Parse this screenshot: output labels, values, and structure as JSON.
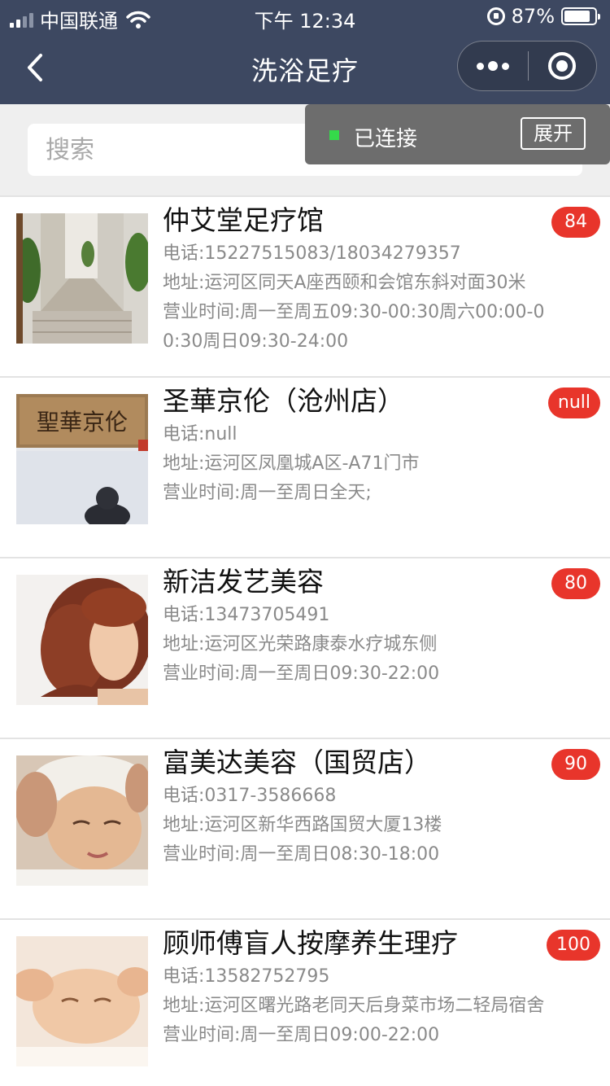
{
  "status_bar": {
    "carrier": "中国联通",
    "time": "下午 12:34",
    "battery": "87%",
    "battery_level": 0.87
  },
  "nav": {
    "title": "洗浴足疗"
  },
  "search": {
    "placeholder": "搜索"
  },
  "toast": {
    "status": "已连接",
    "expand_label": "展开",
    "status_color": "#35d94a"
  },
  "shops": [
    {
      "name": "仲艾堂足疗馆",
      "badge": "84",
      "phone": "电话:15227515083/18034279357",
      "address": "地址:运河区同天A座西颐和会馆东斜对面30米",
      "hours": "营业时间:周一至周五09:30-00:30周六00:00-00:30周日09:30-24:00"
    },
    {
      "name": "圣華京伦（沧州店）",
      "badge": "null",
      "phone": "电话:null",
      "address": "地址:运河区凤凰城A区-A71门市",
      "hours": "营业时间:周一至周日全天;",
      "sign_text": "聖華京伦"
    },
    {
      "name": "新洁发艺美容",
      "badge": "80",
      "phone": "电话:13473705491",
      "address": "地址:运河区光荣路康泰水疗城东侧",
      "hours": "营业时间:周一至周日09:30-22:00"
    },
    {
      "name": "富美达美容（国贸店）",
      "badge": "90",
      "phone": "电话:0317-3586668",
      "address": "地址:运河区新华西路国贸大厦13楼",
      "hours": "营业时间:周一至周日08:30-18:00"
    },
    {
      "name": "顾师傅盲人按摩养生理疗",
      "badge": "100",
      "phone": "电话:13582752795",
      "address": "地址:运河区曙光路老同天后身菜市场二轻局宿舍",
      "hours": "营业时间:周一至周日09:00-22:00"
    }
  ],
  "colors": {
    "nav_bg": "#3d4861",
    "badge_bg": "#e8352b",
    "page_bg": "#efefef"
  }
}
